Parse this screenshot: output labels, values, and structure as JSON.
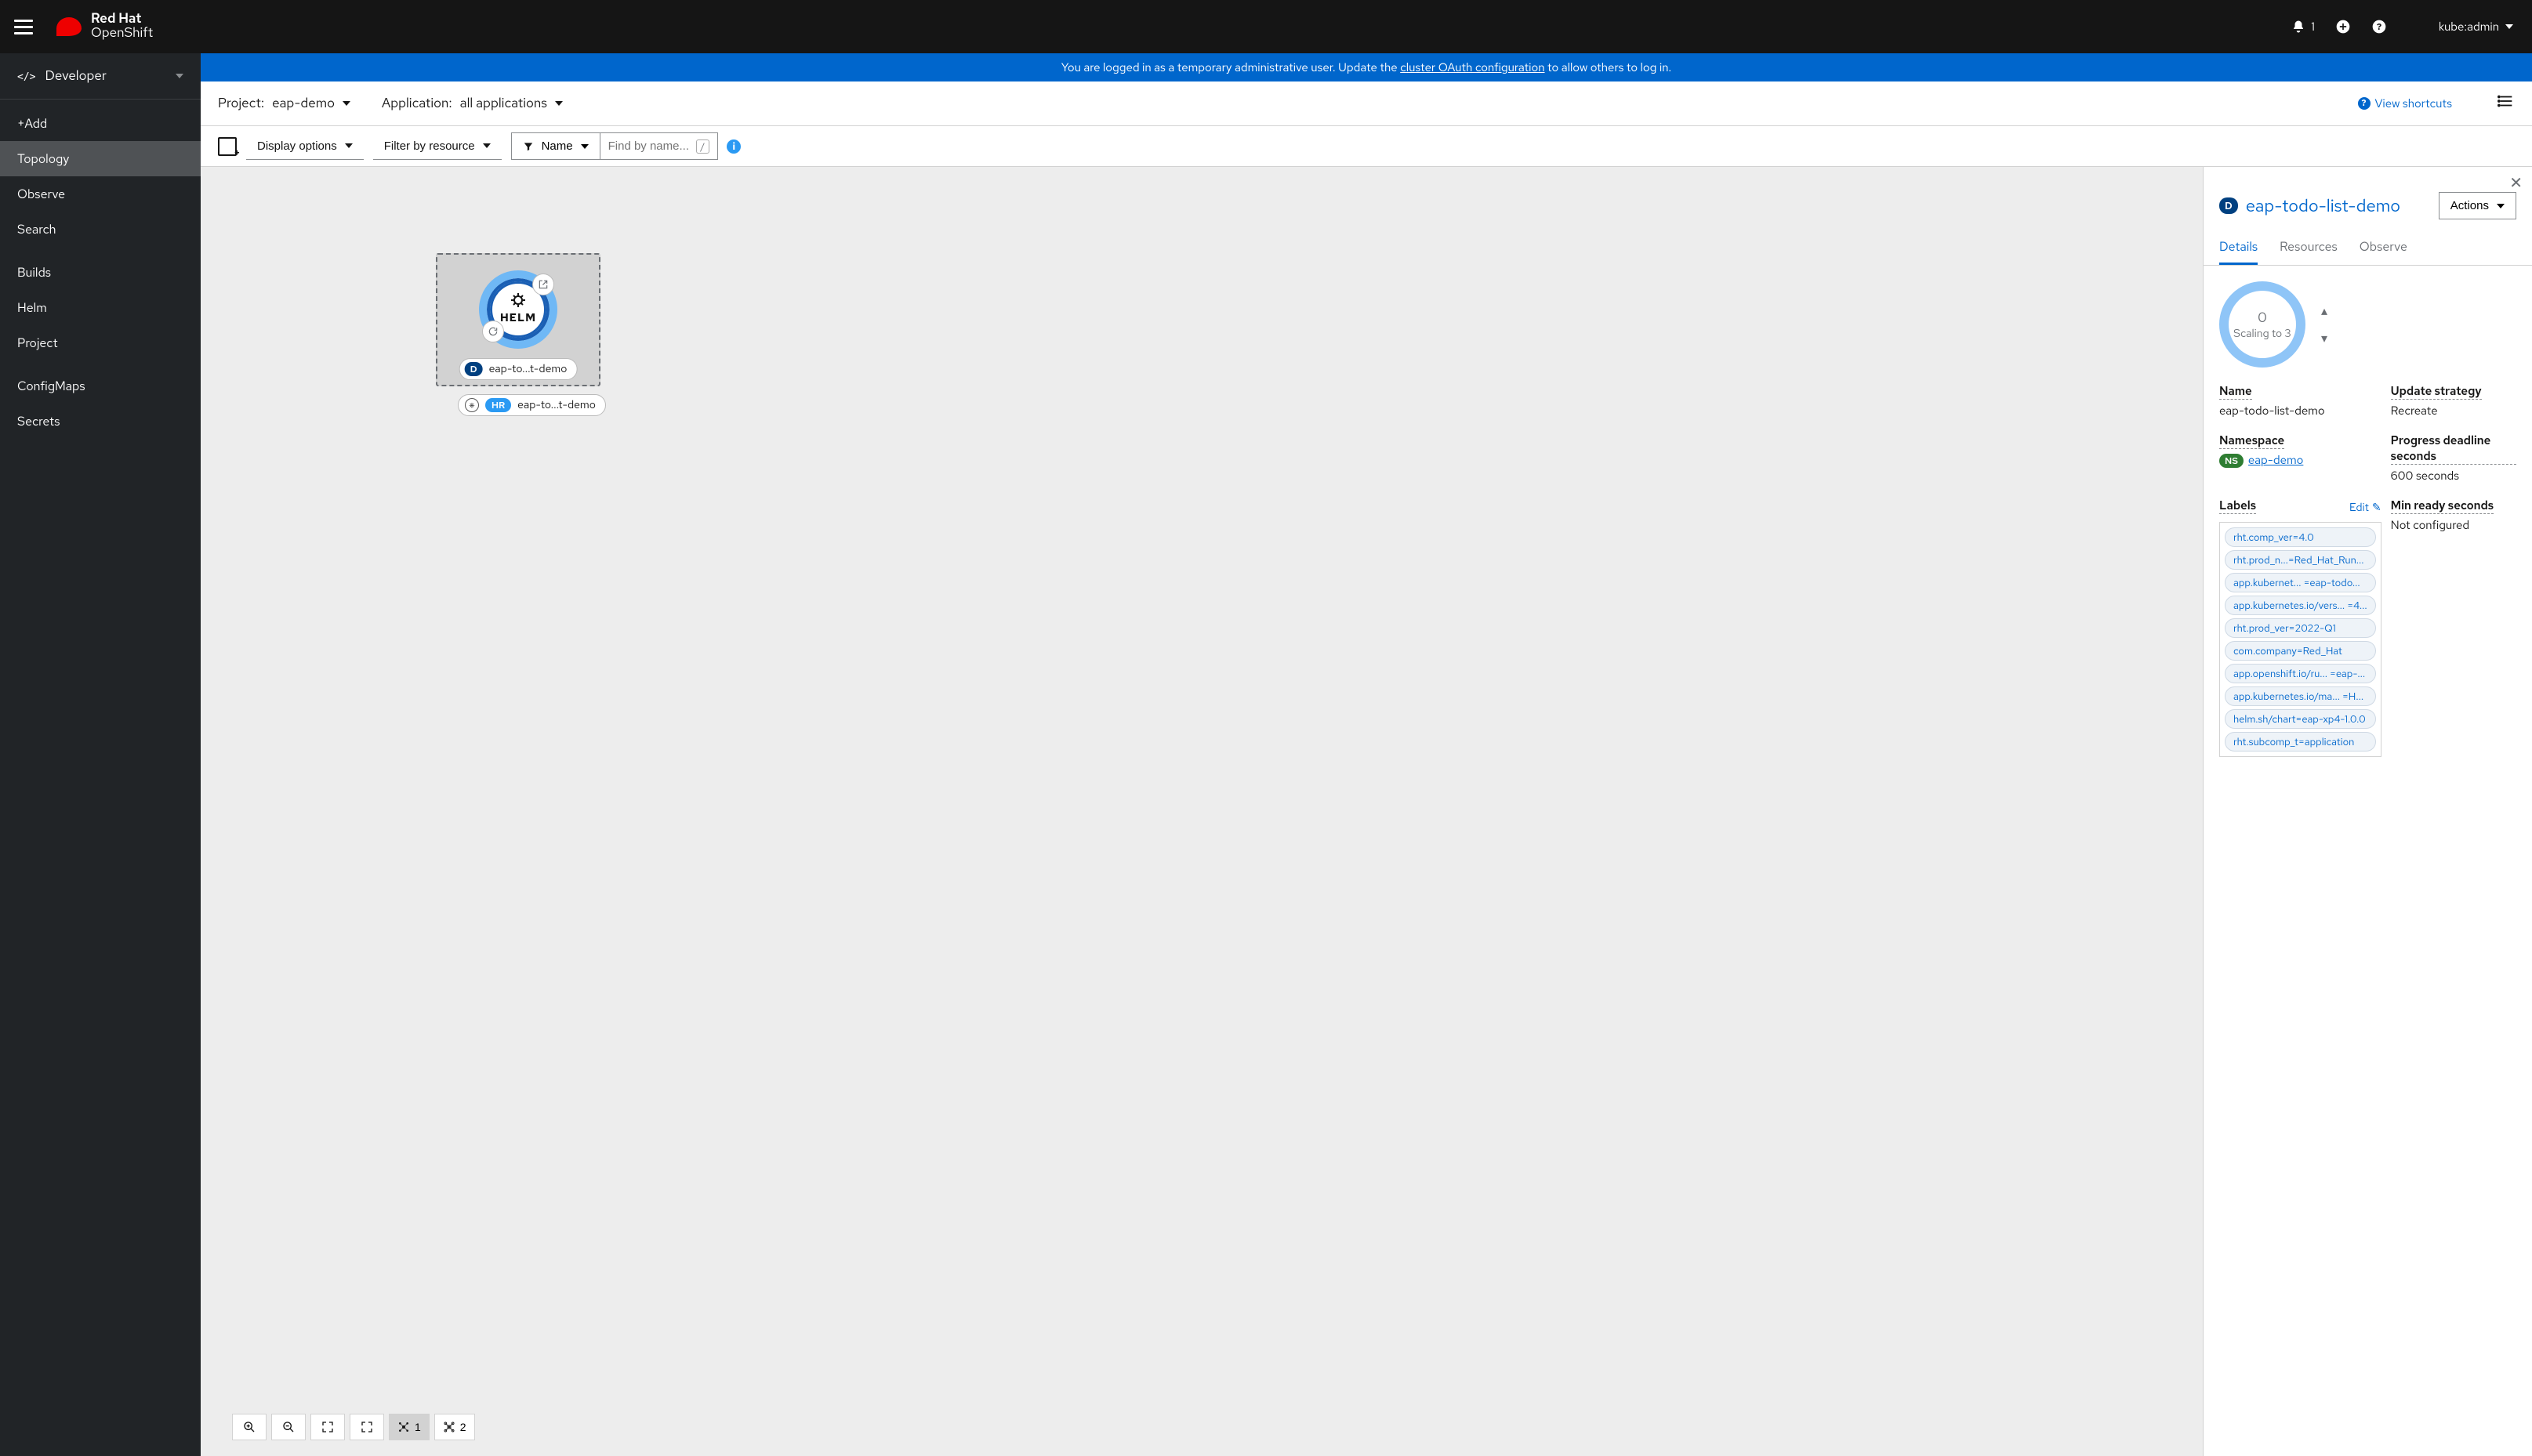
{
  "masthead": {
    "brand_l1": "Red Hat",
    "brand_l2": "OpenShift",
    "notif_count": "1",
    "user": "kube:admin"
  },
  "banner": {
    "pre": "You are logged in as a temporary administrative user. Update the ",
    "link": "cluster OAuth configuration",
    "post": " to allow others to log in."
  },
  "perspective": "Developer",
  "nav": {
    "add": "+Add",
    "topology": "Topology",
    "observe": "Observe",
    "search": "Search",
    "builds": "Builds",
    "helm": "Helm",
    "project": "Project",
    "configmaps": "ConfigMaps",
    "secrets": "Secrets"
  },
  "context": {
    "project_label": "Project: ",
    "project_value": "eap-demo",
    "app_label": "Application: ",
    "app_value": "all applications",
    "shortcuts": "View shortcuts"
  },
  "toolbar": {
    "display": "Display options",
    "filter": "Filter by resource",
    "name": "Name",
    "find_placeholder": "Find by name...",
    "kbd": "/"
  },
  "topo": {
    "helm_label": "HELM",
    "node_name": "eap-to...t-demo",
    "hr_name": "eap-to...t-demo",
    "d_badge": "D",
    "hr_badge": "HR"
  },
  "zoom": {
    "count1": "1",
    "count2": "2"
  },
  "panel": {
    "title": "eap-todo-list-demo",
    "actions": "Actions",
    "tab_details": "Details",
    "tab_resources": "Resources",
    "tab_observe": "Observe",
    "donut_top": "0",
    "donut_sub": "Scaling to 3",
    "name_label": "Name",
    "name_value": "eap-todo-list-demo",
    "update_label": "Update strategy",
    "update_value": "Recreate",
    "ns_label": "Namespace",
    "ns_badge": "NS",
    "ns_value": "eap-demo",
    "pds_label": "Progress deadline seconds",
    "pds_value": "600 seconds",
    "labels_label": "Labels",
    "edit": "Edit",
    "minready_label": "Min ready seconds",
    "minready_value": "Not configured",
    "labels": [
      "rht.comp_ver=4.0",
      "rht.prod_n...=Red_Hat_Run...",
      "app.kubernet... =eap-todo...",
      "app.kubernetes.io/vers... =4...",
      "rht.prod_ver=2022-Q1",
      "com.company=Red_Hat",
      "app.openshift.io/ru... =eap-...",
      "app.kubernetes.io/ma... =H...",
      "helm.sh/chart=eap-xp4-1.0.0",
      "rht.subcomp_t=application"
    ]
  }
}
